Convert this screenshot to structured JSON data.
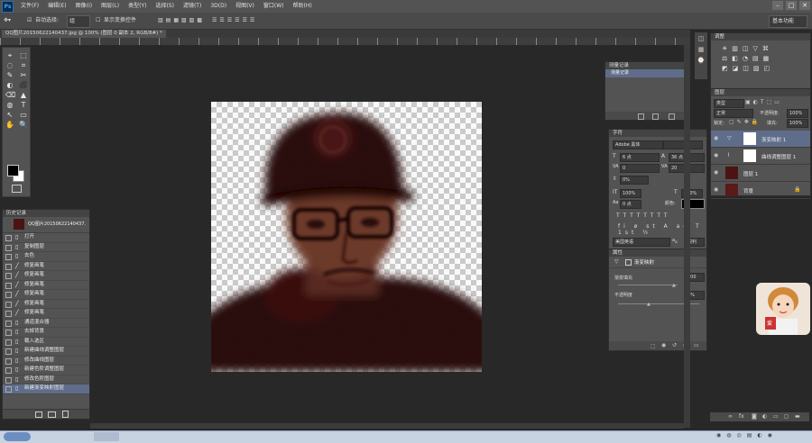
{
  "app": {
    "logo": "Ps"
  },
  "menu": [
    "文件(F)",
    "编辑(E)",
    "图像(I)",
    "图层(L)",
    "类型(Y)",
    "选择(S)",
    "滤镜(T)",
    "3D(D)",
    "视图(V)",
    "窗口(W)",
    "帮助(H)"
  ],
  "window_controls": [
    "–",
    "□",
    "✕"
  ],
  "options": {
    "auto_select_label": "自动选择:",
    "auto_select_value": "组",
    "transform_label": "显示变换控件",
    "workspace": "基本功能"
  },
  "document": {
    "tab_title": "QQ图片20150622140437.jpg @ 100% (图层 0 副本 2, RGB/8#) *"
  },
  "tools": [
    "⌖",
    "⬚",
    "◌",
    "⌗",
    "✎",
    "✂",
    "◐",
    "⬛",
    "⌫",
    "▲",
    "◍",
    "T",
    "↖",
    "▭",
    "✋",
    "🔍"
  ],
  "history": {
    "title": "历史记录",
    "snapshot_label": "QQ图片20150622140437.jpg",
    "items": [
      {
        "label": "打开",
        "icon": "doc"
      },
      {
        "label": "复制图层",
        "icon": "doc"
      },
      {
        "label": "去色",
        "icon": "doc"
      },
      {
        "label": "修复画笔",
        "icon": "brush"
      },
      {
        "label": "修复画笔",
        "icon": "brush"
      },
      {
        "label": "修复画笔",
        "icon": "brush"
      },
      {
        "label": "修复画笔",
        "icon": "brush"
      },
      {
        "label": "修复画笔",
        "icon": "brush"
      },
      {
        "label": "修复画笔",
        "icon": "brush"
      },
      {
        "label": "通道混合器",
        "icon": "doc"
      },
      {
        "label": "去掉背景",
        "icon": "doc"
      },
      {
        "label": "载入选区",
        "icon": "doc"
      },
      {
        "label": "新建曲线调整图层",
        "icon": "doc"
      },
      {
        "label": "修改曲线图层",
        "icon": "doc"
      },
      {
        "label": "新建色阶调整图层",
        "icon": "doc"
      },
      {
        "label": "修改色阶图层",
        "icon": "doc"
      },
      {
        "label": "新建渐变映射图层",
        "icon": "doc"
      }
    ]
  },
  "history_mini": {
    "title": "测量记录",
    "row": "测量记录"
  },
  "char_panel": {
    "title": "字符",
    "font_family": "Adobe 黑体",
    "font_size": "6 点",
    "leading": "36 点",
    "tracking": "0",
    "kerning": "20",
    "scale_v": "0%",
    "vscale": "100%",
    "hscale": "100%",
    "baseline": "0 点",
    "color_label": "颜色:",
    "language": "美国英语",
    "aa": "锐利"
  },
  "properties": {
    "title": "属性",
    "subtitle": "渐变映射",
    "row1_label": "渐变填充",
    "row1_value": "100",
    "row2_label": "不透明度",
    "row2_value": "0%"
  },
  "layers": {
    "title": "图层",
    "kind": "类型",
    "mode": "正常",
    "opacity_label": "不透明度:",
    "opacity": "100%",
    "lock_label": "锁定:",
    "fill_label": "填充:",
    "fill": "100%",
    "items": [
      {
        "name": "渐变映射 1",
        "type": "adjust",
        "selected": true
      },
      {
        "name": "曲线调整图层 1",
        "type": "adjust",
        "selected": false
      },
      {
        "name": "图层 1",
        "type": "photo",
        "selected": false
      },
      {
        "name": "背景",
        "type": "photo",
        "selected": false
      }
    ]
  },
  "adjustments": {
    "title": "调整"
  },
  "popup": {
    "label": "爱"
  },
  "colors": {
    "accent_selection": "#5f6d8a",
    "photo_tint": "#4a1414",
    "panel_bg": "#535353"
  }
}
